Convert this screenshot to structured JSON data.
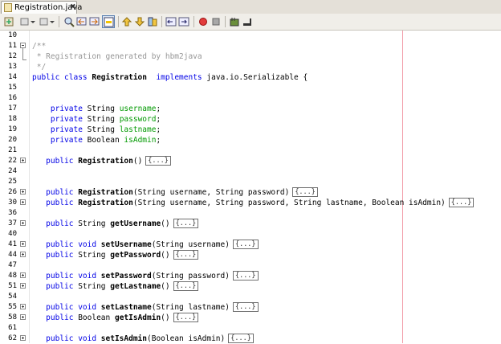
{
  "tab": {
    "title": "Registration.java",
    "close": "✖"
  },
  "toolbar": {
    "buttons": [
      "back-icon",
      "history-icon",
      "last-edit-icon",
      "find-selection-icon",
      "find-previous-icon",
      "find-next-icon",
      "toggle-highlight-icon",
      "previous-bookmark-icon",
      "next-bookmark-icon",
      "toggle-bookmark-icon",
      "shift-left-icon",
      "shift-right-icon",
      "start-macro-icon",
      "stop-macro-icon",
      "comment-icon",
      "uncomment-icon"
    ]
  },
  "editor": {
    "lines": [
      {
        "num": "10",
        "segments": []
      },
      {
        "num": "11",
        "segments": [
          {
            "t": "/**",
            "c": "cm"
          }
        ]
      },
      {
        "num": "12",
        "segments": [
          {
            "t": " * Registration generated by hbm2java",
            "c": "cm"
          }
        ]
      },
      {
        "num": "13",
        "segments": [
          {
            "t": " */",
            "c": "cm"
          }
        ]
      },
      {
        "num": "14",
        "segments": [
          {
            "t": "public class ",
            "c": "kw"
          },
          {
            "t": "Registration",
            "c": "b"
          },
          {
            "t": "  "
          },
          {
            "t": "implements",
            "c": "kw"
          },
          {
            "t": " java.io.Serializable {"
          }
        ]
      },
      {
        "num": "15",
        "segments": []
      },
      {
        "num": "16",
        "segments": []
      },
      {
        "num": "17",
        "segments": [
          {
            "t": "    private ",
            "c": "kw"
          },
          {
            "t": "String "
          },
          {
            "t": "username",
            "c": "fld"
          },
          {
            "t": ";"
          }
        ]
      },
      {
        "num": "18",
        "segments": [
          {
            "t": "    private ",
            "c": "kw"
          },
          {
            "t": "String "
          },
          {
            "t": "password",
            "c": "fld"
          },
          {
            "t": ";"
          }
        ]
      },
      {
        "num": "19",
        "segments": [
          {
            "t": "    private ",
            "c": "kw"
          },
          {
            "t": "String "
          },
          {
            "t": "lastname",
            "c": "fld"
          },
          {
            "t": ";"
          }
        ]
      },
      {
        "num": "20",
        "segments": [
          {
            "t": "    private ",
            "c": "kw"
          },
          {
            "t": "Boolean "
          },
          {
            "t": "isAdmin",
            "c": "fld"
          },
          {
            "t": ";"
          }
        ]
      },
      {
        "num": "21",
        "segments": []
      },
      {
        "num": "22",
        "segments": [
          {
            "t": "   public ",
            "c": "kw"
          },
          {
            "t": "Registration",
            "c": "b"
          },
          {
            "t": "()"
          }
        ],
        "collapsed": "{...}"
      },
      {
        "num": "24",
        "segments": []
      },
      {
        "num": "25",
        "segments": []
      },
      {
        "num": "26",
        "segments": [
          {
            "t": "   public ",
            "c": "kw"
          },
          {
            "t": "Registration",
            "c": "b"
          },
          {
            "t": "(String username, String password)"
          }
        ],
        "collapsed": "{...}"
      },
      {
        "num": "30",
        "segments": [
          {
            "t": "   public ",
            "c": "kw"
          },
          {
            "t": "Registration",
            "c": "b"
          },
          {
            "t": "(String username, String password, String lastname, Boolean isAdmin)"
          }
        ],
        "collapsed": "{...}"
      },
      {
        "num": "36",
        "segments": []
      },
      {
        "num": "37",
        "segments": [
          {
            "t": "   public ",
            "c": "kw"
          },
          {
            "t": "String "
          },
          {
            "t": "getUsername",
            "c": "b"
          },
          {
            "t": "()"
          }
        ],
        "collapsed": "{...}"
      },
      {
        "num": "40",
        "segments": []
      },
      {
        "num": "41",
        "segments": [
          {
            "t": "   public void ",
            "c": "kw"
          },
          {
            "t": "setUsername",
            "c": "b"
          },
          {
            "t": "(String username)"
          }
        ],
        "collapsed": "{...}"
      },
      {
        "num": "44",
        "segments": [
          {
            "t": "   public ",
            "c": "kw"
          },
          {
            "t": "String "
          },
          {
            "t": "getPassword",
            "c": "b"
          },
          {
            "t": "()"
          }
        ],
        "collapsed": "{...}"
      },
      {
        "num": "47",
        "segments": []
      },
      {
        "num": "48",
        "segments": [
          {
            "t": "   public void ",
            "c": "kw"
          },
          {
            "t": "setPassword",
            "c": "b"
          },
          {
            "t": "(String password)"
          }
        ],
        "collapsed": "{...}"
      },
      {
        "num": "51",
        "segments": [
          {
            "t": "   public ",
            "c": "kw"
          },
          {
            "t": "String "
          },
          {
            "t": "getLastname",
            "c": "b"
          },
          {
            "t": "()"
          }
        ],
        "collapsed": "{...}"
      },
      {
        "num": "54",
        "segments": []
      },
      {
        "num": "55",
        "segments": [
          {
            "t": "   public void ",
            "c": "kw"
          },
          {
            "t": "setLastname",
            "c": "b"
          },
          {
            "t": "(String lastname)"
          }
        ],
        "collapsed": "{...}"
      },
      {
        "num": "58",
        "segments": [
          {
            "t": "   public ",
            "c": "kw"
          },
          {
            "t": "Boolean "
          },
          {
            "t": "getIsAdmin",
            "c": "b"
          },
          {
            "t": "()"
          }
        ],
        "collapsed": "{...}"
      },
      {
        "num": "61",
        "segments": []
      },
      {
        "num": "62",
        "segments": [
          {
            "t": "   public void ",
            "c": "kw"
          },
          {
            "t": "setIsAdmin",
            "c": "b"
          },
          {
            "t": "(Boolean isAdmin)"
          }
        ],
        "collapsed": "{...}"
      }
    ]
  }
}
